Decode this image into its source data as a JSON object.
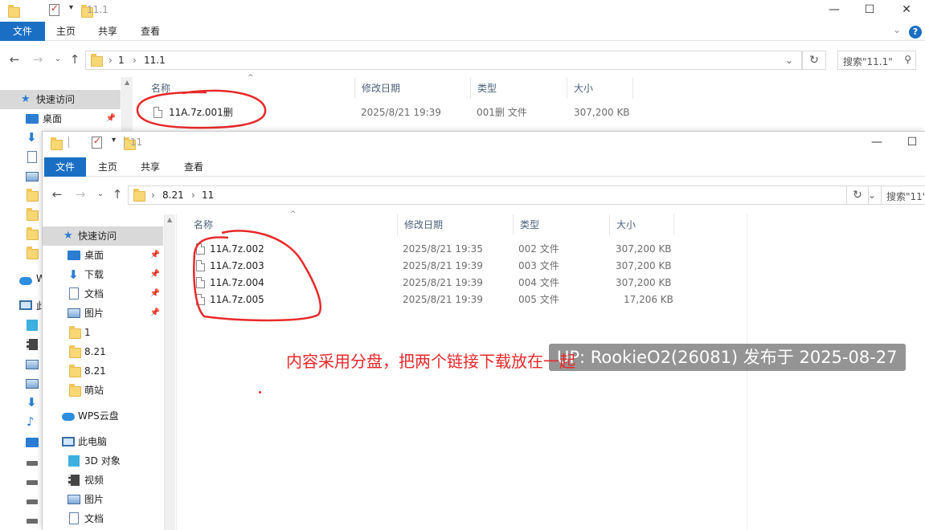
{
  "window1": {
    "title": "11.1",
    "ribbon_tabs": [
      "文件",
      "主页",
      "共享",
      "查看"
    ],
    "address": {
      "crumbs": [
        "1",
        "11.1"
      ]
    },
    "search": {
      "placeholder": "搜索\"11.1\""
    },
    "columns": [
      "名称",
      "修改日期",
      "类型",
      "大小"
    ],
    "files": [
      {
        "name": "11A.7z.001删",
        "modified": "2025/8/21 19:39",
        "type": "001删 文件",
        "size": "307,200 KB"
      }
    ],
    "nav": [
      {
        "label": "快速访问"
      },
      {
        "label": "桌面"
      }
    ],
    "nav_partial": [
      "W",
      "此"
    ]
  },
  "window2": {
    "title": "11",
    "ribbon_tabs": [
      "文件",
      "主页",
      "共享",
      "查看"
    ],
    "address": {
      "crumbs": [
        "8.21",
        "11"
      ]
    },
    "search": {
      "placeholder": "搜索\"11\""
    },
    "columns": [
      "名称",
      "修改日期",
      "类型",
      "大小"
    ],
    "files": [
      {
        "name": "11A.7z.002",
        "modified": "2025/8/21 19:35",
        "type": "002 文件",
        "size": "307,200 KB"
      },
      {
        "name": "11A.7z.003",
        "modified": "2025/8/21 19:39",
        "type": "003 文件",
        "size": "307,200 KB"
      },
      {
        "name": "11A.7z.004",
        "modified": "2025/8/21 19:39",
        "type": "004 文件",
        "size": "307,200 KB"
      },
      {
        "name": "11A.7z.005",
        "modified": "2025/8/21 19:39",
        "type": "005 文件",
        "size": "17,206 KB"
      }
    ],
    "nav": [
      {
        "label": "快速访问",
        "icon": "star-icon"
      },
      {
        "label": "桌面",
        "icon": "desktop-icon",
        "pinned": true
      },
      {
        "label": "下载",
        "icon": "download-icon",
        "pinned": true
      },
      {
        "label": "文档",
        "icon": "document-icon",
        "pinned": true
      },
      {
        "label": "图片",
        "icon": "picture-icon",
        "pinned": true
      },
      {
        "label": "1",
        "icon": "folder-icon"
      },
      {
        "label": "8.21",
        "icon": "folder-icon"
      },
      {
        "label": "8.21",
        "icon": "folder-icon"
      },
      {
        "label": "萌站",
        "icon": "folder-icon"
      },
      {
        "label": "WPS云盘",
        "icon": "cloud-icon"
      },
      {
        "label": "此电脑",
        "icon": "pc-icon"
      },
      {
        "label": "3D 对象",
        "icon": "cube-icon"
      },
      {
        "label": "视频",
        "icon": "video-icon"
      },
      {
        "label": "图片",
        "icon": "picture-icon"
      },
      {
        "label": "文档",
        "icon": "document-icon"
      }
    ]
  },
  "overlay": {
    "annotation_text": "内容采用分盘，把两个链接下载放在一起",
    "watermark_text": "UP: RookieO2(26081) 发布于 2025-08-27"
  },
  "colors": {
    "ribbon_file_tab": "#1a6fc4",
    "annotation_red": "#e8292a"
  }
}
